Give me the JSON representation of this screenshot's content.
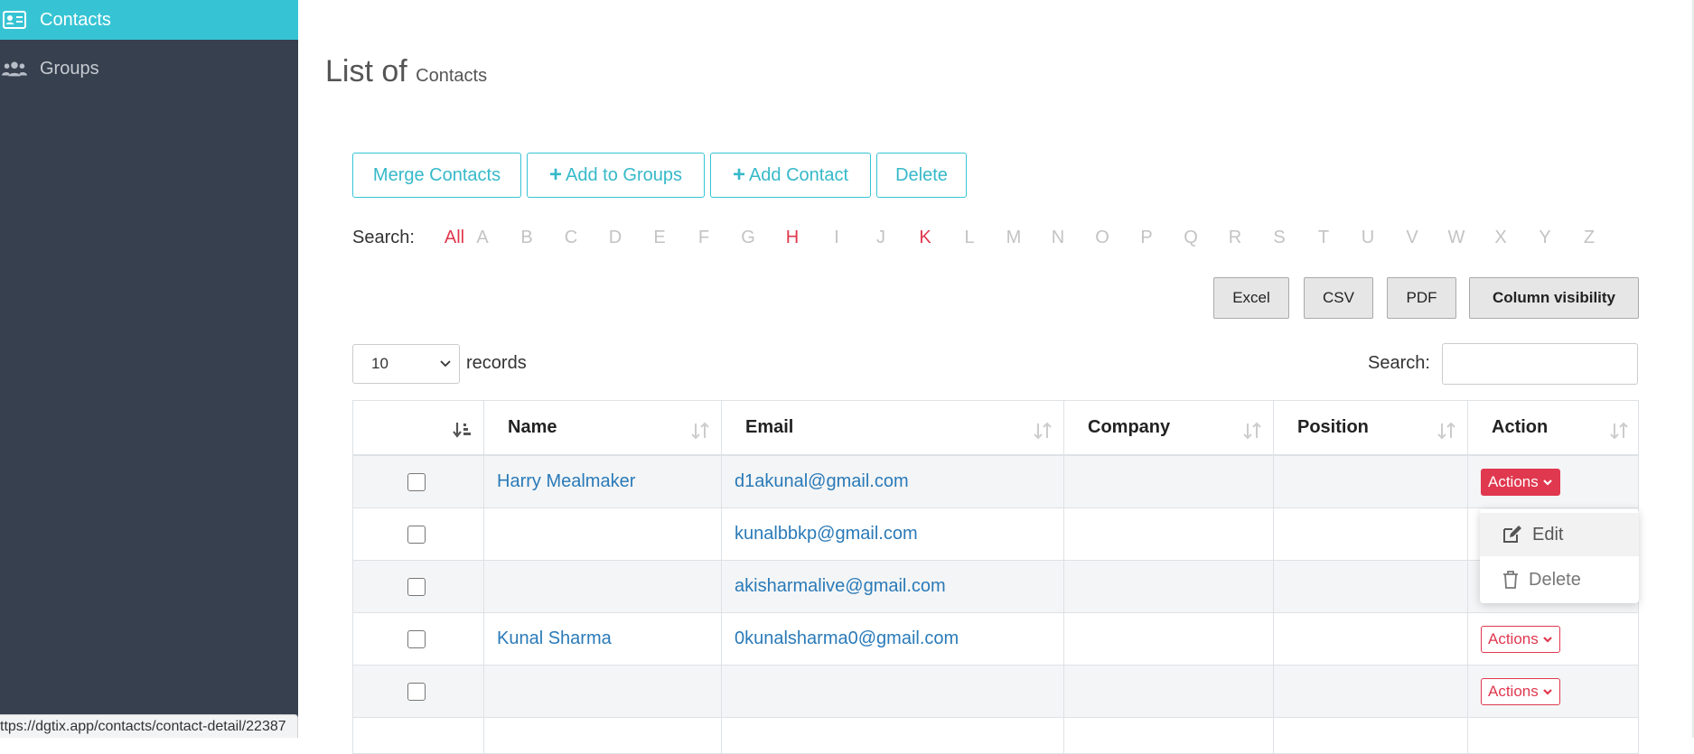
{
  "sidebar": {
    "items": [
      {
        "label": "Contacts",
        "icon": "contact-card-icon",
        "active": true
      },
      {
        "label": "Groups",
        "icon": "users-icon",
        "active": false
      }
    ]
  },
  "page": {
    "title_main": "List of",
    "title_sub": "Contacts"
  },
  "toolbar": {
    "merge_label": "Merge Contacts",
    "add_groups_label": "Add to Groups",
    "add_contact_label": "Add Contact",
    "delete_label": "Delete"
  },
  "alpha_filter": {
    "label": "Search:",
    "all": "All",
    "letters": [
      "A",
      "B",
      "C",
      "D",
      "E",
      "F",
      "G",
      "H",
      "I",
      "J",
      "K",
      "L",
      "M",
      "N",
      "O",
      "P",
      "Q",
      "R",
      "S",
      "T",
      "U",
      "V",
      "W",
      "X",
      "Y",
      "Z"
    ],
    "highlighted": [
      "All",
      "H",
      "K"
    ]
  },
  "export": {
    "excel": "Excel",
    "csv": "CSV",
    "pdf": "PDF",
    "colvis": "Column visibility"
  },
  "length": {
    "selected": "10",
    "records_label": "records"
  },
  "search": {
    "label": "Search:",
    "value": ""
  },
  "table": {
    "headers": [
      "",
      "Name",
      "Email",
      "Company",
      "Position",
      "Action"
    ],
    "rows": [
      {
        "name": "Harry Mealmaker",
        "email": "d1akunal@gmail.com",
        "company": "",
        "position": "",
        "action": "Actions",
        "action_style": "filled"
      },
      {
        "name": "",
        "email": "kunalbbkp@gmail.com",
        "company": "",
        "position": "",
        "action": "",
        "action_style": "hidden"
      },
      {
        "name": "",
        "email": "akisharmalive@gmail.com",
        "company": "",
        "position": "",
        "action": "",
        "action_style": "hidden"
      },
      {
        "name": "Kunal Sharma",
        "email": "0kunalsharma0@gmail.com",
        "company": "",
        "position": "",
        "action": "Actions",
        "action_style": "outline"
      },
      {
        "name": "",
        "email": "",
        "company": "",
        "position": "",
        "action": "Actions",
        "action_style": "outline"
      }
    ]
  },
  "action_menu": {
    "edit": "Edit",
    "delete": "Delete"
  },
  "status_bar": {
    "url": "ttps://dgtix.app/contacts/contact-detail/22387"
  },
  "colors": {
    "accent": "#36c4d4",
    "danger": "#e0384e",
    "sidebar_bg": "#36404f",
    "link": "#2a7ab8"
  }
}
